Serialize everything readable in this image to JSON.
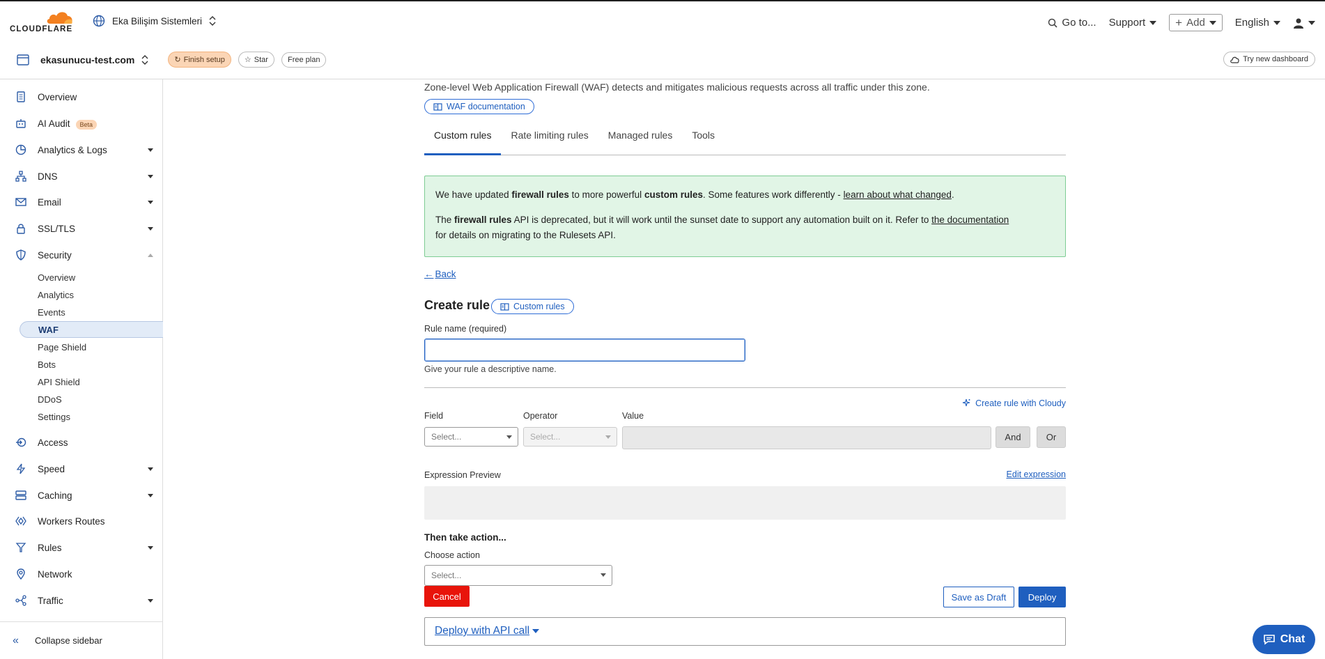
{
  "header": {
    "brand": "CLOUDFLARE",
    "account_name": "Eka Bilişim Sistemleri",
    "goto_label": "Go to...",
    "support_label": "Support",
    "add_label": "Add",
    "language_label": "English"
  },
  "zone": {
    "domain": "ekasunucu-test.com",
    "finish_setup_label": "Finish setup",
    "star_label": "Star",
    "plan_label": "Free plan",
    "try_new_label": "Try new dashboard"
  },
  "sidebar": {
    "items": [
      {
        "label": "Overview",
        "icon": "document-icon"
      },
      {
        "label": "AI Audit",
        "badge": "Beta",
        "icon": "robot-icon"
      },
      {
        "label": "Analytics & Logs",
        "icon": "chart-icon"
      },
      {
        "label": "DNS",
        "icon": "network-icon"
      },
      {
        "label": "Email",
        "icon": "email-icon"
      },
      {
        "label": "SSL/TLS",
        "icon": "lock-icon"
      },
      {
        "label": "Security",
        "icon": "shield-icon"
      },
      {
        "label": "Access",
        "icon": "access-icon"
      },
      {
        "label": "Speed",
        "icon": "lightning-icon"
      },
      {
        "label": "Caching",
        "icon": "server-icon"
      },
      {
        "label": "Workers Routes",
        "icon": "workers-icon"
      },
      {
        "label": "Rules",
        "icon": "rules-icon"
      },
      {
        "label": "Network",
        "icon": "location-icon"
      },
      {
        "label": "Traffic",
        "icon": "traffic-icon"
      }
    ],
    "security_sub": [
      "Overview",
      "Analytics",
      "Events",
      "WAF",
      "Page Shield",
      "Bots",
      "API Shield",
      "DDoS",
      "Settings"
    ],
    "collapse_label": "Collapse sidebar"
  },
  "main": {
    "description": "Zone-level Web Application Firewall (WAF) detects and mitigates malicious requests across all traffic under this zone.",
    "waf_doc_label": "WAF documentation",
    "tabs": [
      "Custom rules",
      "Rate limiting rules",
      "Managed rules",
      "Tools"
    ],
    "notice": {
      "l1_a": "We have updated ",
      "l1_b": "firewall rules",
      "l1_c": " to more powerful ",
      "l1_d": "custom rules",
      "l1_e": ". Some features work differently - ",
      "l1_link": "learn about what changed",
      "l1_f": ".",
      "l2_a": "The ",
      "l2_b": "firewall rules",
      "l2_c": " API is deprecated, but it will work until the sunset date to support any automation built on it. Refer to ",
      "l2_link": "the documentation",
      "l2_d": "for details on migrating to the Rulesets API."
    },
    "back_label": "Back",
    "create_title": "Create rule",
    "custom_rules_doc": "Custom rules",
    "rule_name_label": "Rule name (required)",
    "rule_name_value": "",
    "rule_name_hint": "Give your rule a descriptive name.",
    "cloudy_label": "Create rule with Cloudy",
    "field_label": "Field",
    "operator_label": "Operator",
    "value_label": "Value",
    "field_placeholder": "Select...",
    "operator_placeholder": "Select...",
    "and_label": "And",
    "or_label": "Or",
    "expr_preview_label": "Expression Preview",
    "edit_expr_label": "Edit expression",
    "then_label": "Then take action...",
    "choose_action_label": "Choose action",
    "action_placeholder": "Select...",
    "cancel_label": "Cancel",
    "draft_label": "Save as Draft",
    "deploy_label": "Deploy",
    "api_label": "Deploy with API call"
  },
  "chat_label": "Chat",
  "colors": {
    "accent": "#1f5fbf",
    "brand_orange": "#f38020",
    "danger": "#e8140a",
    "notice_bg": "#e1f5e6"
  }
}
